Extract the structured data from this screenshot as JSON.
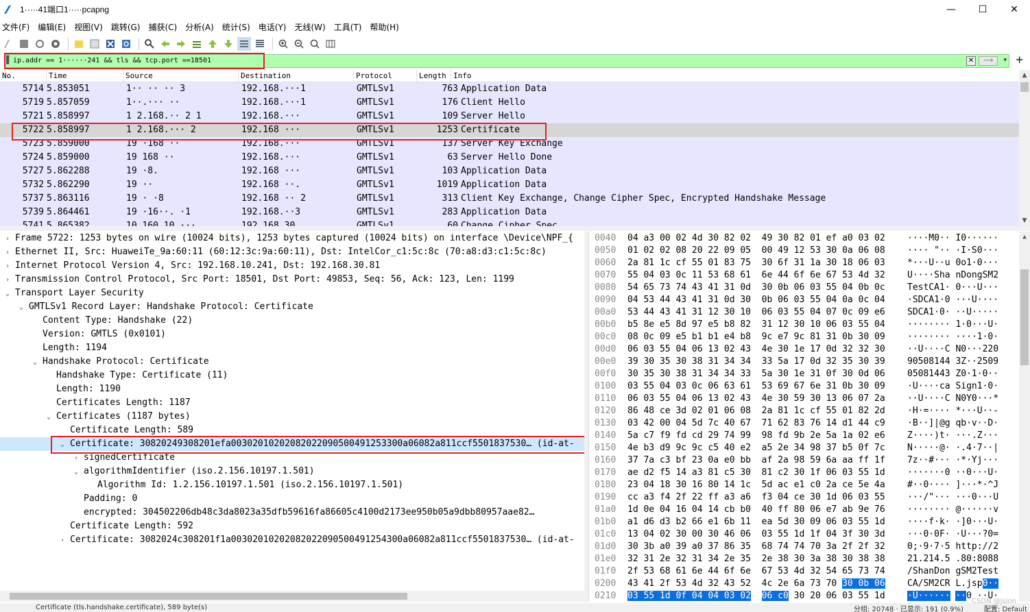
{
  "window": {
    "title": "1·····41端口1·····pcapng",
    "minimize": "—",
    "maximize": "☐",
    "close": "✕"
  },
  "menu": [
    "文件(F)",
    "编辑(E)",
    "视图(V)",
    "跳转(G)",
    "捕获(C)",
    "分析(A)",
    "统计(S)",
    "电话(Y)",
    "无线(W)",
    "工具(T)",
    "帮助(H)"
  ],
  "filter": {
    "value": "ip.addr == 1······241 && tls && tcp.port ==18501",
    "plus": "+"
  },
  "packet_list": {
    "columns": [
      "No.",
      "Time",
      "Source",
      "Destination",
      "Protocol",
      "Length",
      "Info"
    ],
    "rows": [
      {
        "no": "5714",
        "time": "5.853051",
        "src": "1·· ·· ·· 3",
        "dst": "192.168.···1",
        "proto": "GMTLSv1",
        "len": "763",
        "info": "Application Data"
      },
      {
        "no": "5719",
        "time": "5.857059",
        "src": "1··.··· ··",
        "dst": "192.168.···1",
        "proto": "GMTLSv1",
        "len": "176",
        "info": "Client Hello"
      },
      {
        "no": "5721",
        "time": "5.858997",
        "src": "1 2.168.·· 2 1",
        "dst": "192.168.···",
        "proto": "GMTLSv1",
        "len": "109",
        "info": "Server Hello"
      },
      {
        "no": "5722",
        "time": "5.858997",
        "src": "1 2.168.··· 2",
        "dst": "192.168 ···",
        "proto": "GMTLSv1",
        "len": "1253",
        "info": "Certificate"
      },
      {
        "no": "5723",
        "time": "5.859000",
        "src": "19 ·168 ··",
        "dst": "192.168.···",
        "proto": "GMTLSv1",
        "len": "137",
        "info": "Server Key Exchange"
      },
      {
        "no": "5724",
        "time": "5.859000",
        "src": "19 168 ··",
        "dst": "192.168.···",
        "proto": "GMTLSv1",
        "len": "63",
        "info": "Server Hello Done"
      },
      {
        "no": "5727",
        "time": "5.862288",
        "src": "19 ·8.",
        "dst": "192.168 ···",
        "proto": "GMTLSv1",
        "len": "103",
        "info": "Application Data"
      },
      {
        "no": "5732",
        "time": "5.862290",
        "src": "19 ··",
        "dst": "192.168 ··.",
        "proto": "GMTLSv1",
        "len": "1019",
        "info": "Application Data"
      },
      {
        "no": "5737",
        "time": "5.863116",
        "src": "19 · ·8",
        "dst": "192.168 ·· 2",
        "proto": "GMTLSv1",
        "len": "313",
        "info": "Client Key Exchange, Change Cipher Spec, Encrypted Handshake Message"
      },
      {
        "no": "5739",
        "time": "5.864461",
        "src": "19 ·16··. ·1",
        "dst": "192.168.··3",
        "proto": "GMTLSv1",
        "len": "283",
        "info": "Application Data"
      },
      {
        "no": "5741",
        "time": "5.865382",
        "src": "10 160 10 ···",
        "dst": "192.168.30",
        "proto": "GMTLSv1",
        "len": "60",
        "info": "Change Cipher Spec"
      }
    ]
  },
  "details": [
    {
      "indent": 0,
      "arrow": "›",
      "text": "Frame 5722: 1253 bytes on wire (10024 bits), 1253 bytes captured (10024 bits) on interface \\Device\\NPF_{"
    },
    {
      "indent": 0,
      "arrow": "›",
      "text": "Ethernet II, Src: HuaweiTe_9a:60:11 (60:12:3c:9a:60:11), Dst: IntelCor_c1:5c:8c (70:a8:d3:c1:5c:8c)"
    },
    {
      "indent": 0,
      "arrow": "›",
      "text": "Internet Protocol Version 4, Src: 192.168.10.241, Dst: 192.168.30.81"
    },
    {
      "indent": 0,
      "arrow": "›",
      "text": "Transmission Control Protocol, Src Port: 18501, Dst Port: 49853, Seq: 56, Ack: 123, Len: 1199"
    },
    {
      "indent": 0,
      "arrow": "⌄",
      "text": "Transport Layer Security"
    },
    {
      "indent": 1,
      "arrow": "⌄",
      "text": "GMTLSv1 Record Layer: Handshake Protocol: Certificate"
    },
    {
      "indent": 2,
      "arrow": "",
      "text": "Content Type: Handshake (22)"
    },
    {
      "indent": 2,
      "arrow": "",
      "text": "Version: GMTLS (0x0101)"
    },
    {
      "indent": 2,
      "arrow": "",
      "text": "Length: 1194"
    },
    {
      "indent": 2,
      "arrow": "⌄",
      "text": "Handshake Protocol: Certificate"
    },
    {
      "indent": 3,
      "arrow": "",
      "text": "Handshake Type: Certificate (11)"
    },
    {
      "indent": 3,
      "arrow": "",
      "text": "Length: 1190"
    },
    {
      "indent": 3,
      "arrow": "",
      "text": "Certificates Length: 1187"
    },
    {
      "indent": 3,
      "arrow": "⌄",
      "text": "Certificates (1187 bytes)"
    },
    {
      "indent": 4,
      "arrow": "",
      "text": "Certificate Length: 589"
    },
    {
      "indent": 4,
      "arrow": "⌄",
      "text": "Certificate: 30820249308201efa003020102020820220905004912533​00a06082a811ccf5501837530… (id-at-",
      "sel": true
    },
    {
      "indent": 5,
      "arrow": "›",
      "text": "signedCertificate"
    },
    {
      "indent": 5,
      "arrow": "⌄",
      "text": "algorithmIdentifier (iso.2.156.10197.1.501)"
    },
    {
      "indent": 6,
      "arrow": "",
      "text": "Algorithm Id: 1.2.156.10197.1.501 (iso.2.156.10197.1.501)"
    },
    {
      "indent": 5,
      "arrow": "",
      "text": "Padding: 0"
    },
    {
      "indent": 5,
      "arrow": "",
      "text": "encrypted: 304502206db48c3da8023a35dfb59616fa86605c4100d2173ee950b05a9dbb80957aae82…"
    },
    {
      "indent": 4,
      "arrow": "",
      "text": "Certificate Length: 592"
    },
    {
      "indent": 4,
      "arrow": "›",
      "text": "Certificate: 3082024c308201f1a003020102020820220905004912543​00a06082a811ccf5501837530… (id-at-"
    }
  ],
  "hex": [
    {
      "off": "0040",
      "b1": "04 a3 00 02 4d 30 82 02",
      "b2": "49 30 82 01 ef a0 03 02",
      "asc": "····M0·· I0······"
    },
    {
      "off": "0050",
      "b1": "01 02 02 08 20 22 09 05",
      "b2": "00 49 12 53 30 0a 06 08",
      "asc": "···· \"·· ·I·S0···"
    },
    {
      "off": "0060",
      "b1": "2a 81 1c cf 55 01 83 75",
      "b2": "30 6f 31 1a 30 18 06 03",
      "asc": "*···U··u 0o1·0···"
    },
    {
      "off": "0070",
      "b1": "55 04 03 0c 11 53 68 61",
      "b2": "6e 44 6f 6e 67 53 4d 32",
      "asc": "U····Sha nDongSM2"
    },
    {
      "off": "0080",
      "b1": "54 65 73 74 43 41 31 0d",
      "b2": "30 0b 06 03 55 04 0b 0c",
      "asc": "TestCA1· 0···U···"
    },
    {
      "off": "0090",
      "b1": "04 53 44 43 41 31 0d 30",
      "b2": "0b 06 03 55 04 0a 0c 04",
      "asc": "·SDCA1·0 ···U····"
    },
    {
      "off": "00a0",
      "b1": "53 44 43 41 31 12 30 10",
      "b2": "06 03 55 04 07 0c 09 e6",
      "asc": "SDCA1·0· ··U·····"
    },
    {
      "off": "00b0",
      "b1": "b5 8e e5 8d 97 e5 b8 82",
      "b2": "31 12 30 10 06 03 55 04",
      "asc": "········ 1·0···U·"
    },
    {
      "off": "00c0",
      "b1": "08 0c 09 e5 b1 b1 e4 b8",
      "b2": "9c e7 9c 81 31 0b 30 09",
      "asc": "········ ····1·0·"
    },
    {
      "off": "00d0",
      "b1": "06 03 55 04 06 13 02 43",
      "b2": "4e 30 1e 17 0d 32 32 30",
      "asc": "··U····C N0···220"
    },
    {
      "off": "00e0",
      "b1": "39 30 35 30 38 31 34 34",
      "b2": "33 5a 17 0d 32 35 30 39",
      "asc": "90508144 3Z··2509"
    },
    {
      "off": "00f0",
      "b1": "30 35 30 38 31 34 34 33",
      "b2": "5a 30 1e 31 0f 30 0d 06",
      "asc": "05081443 Z0·1·0··"
    },
    {
      "off": "0100",
      "b1": "03 55 04 03 0c 06 63 61",
      "b2": "53 69 67 6e 31 0b 30 09",
      "asc": "·U····ca Sign1·0·"
    },
    {
      "off": "0110",
      "b1": "06 03 55 04 06 13 02 43",
      "b2": "4e 30 59 30 13 06 07 2a",
      "asc": "··U····C N0Y0···*"
    },
    {
      "off": "0120",
      "b1": "86 48 ce 3d 02 01 06 08",
      "b2": "2a 81 1c cf 55 01 82 2d",
      "asc": "·H·=···· *···U··-"
    },
    {
      "off": "0130",
      "b1": "03 42 00 04 5d 7c 40 67",
      "b2": "71 62 83 76 14 d1 44 c9",
      "asc": "·B··]|@g qb·v··D·"
    },
    {
      "off": "0140",
      "b1": "5a c7 f9 fd cd 29 74 99",
      "b2": "98 fd 9b 2e 5a 1a 02 e6",
      "asc": "Z····)t· ···.Z···"
    },
    {
      "off": "0150",
      "b1": "4e b3 d9 9c 9c c5 40 e2",
      "b2": "a5 2e 34 98 37 b5 0f 7c",
      "asc": "N·····@· ·.4·7··|"
    },
    {
      "off": "0160",
      "b1": "37 7a c3 bf 23 0a e0 bb",
      "b2": "af 2a 98 59 6a aa ff 1f",
      "asc": "7z··#··· ·*·Yj···"
    },
    {
      "off": "0170",
      "b1": "ae d2 f5 14 a3 81 c5 30",
      "b2": "81 c2 30 1f 06 03 55 1d",
      "asc": "·······0 ··0···U·"
    },
    {
      "off": "0180",
      "b1": "23 04 18 30 16 80 14 1c",
      "b2": "5d ac e1 c0 2a ce 5e 4a",
      "asc": "#··0···· ]···*·^J"
    },
    {
      "off": "0190",
      "b1": "cc a3 f4 2f 22 ff a3 a6",
      "b2": "f3 04 ce 30 1d 06 03 55",
      "asc": "···/\"··· ···0···U"
    },
    {
      "off": "01a0",
      "b1": "1d 0e 04 16 04 14 cb b0",
      "b2": "40 ff 80 06 e7 ab 9e 76",
      "asc": "········ @······v"
    },
    {
      "off": "01b0",
      "b1": "a1 d6 d3 b2 66 e1 6b 11",
      "b2": "ea 5d 30 09 06 03 55 1d",
      "asc": "····f·k· ·]0···U·"
    },
    {
      "off": "01c0",
      "b1": "13 04 02 30 00 30 46 06",
      "b2": "03 55 1d 1f 04 3f 30 3d",
      "asc": "···0·0F· ·U···?0="
    },
    {
      "off": "01d0",
      "b1": "30 3b a0 39 a0 37 86 35",
      "b2": "68 74 74 70 3a 2f 2f 32",
      "asc": "0;·9·7·5 http://2"
    },
    {
      "off": "01e0",
      "b1": "32 31 2e 32 31 34 2e 35",
      "b2": "2e 38 30 3a 38 30 38 38",
      "asc": "21.214.5 .80:8088"
    },
    {
      "off": "01f0",
      "b1": "2f 53 68 61 6e 44 6f 6e",
      "b2": "67 53 4d 32 54 65 73 74",
      "asc": "/ShanDon gSM2Test"
    },
    {
      "off": "0200",
      "b1": "43 41 2f 53 4d 32 43 52",
      "b2": "4c 2e 6a 73 70",
      "b2hl": "30 0b 06",
      "asc": "CA/SM2CR L.jsp",
      "aschl": "0··"
    },
    {
      "off": "0210",
      "b1hl": "03 55 1d 0f 04 04 03 02",
      "b2hl": "06 c0",
      "b2": "30 20 06 03 55 1d",
      "aschl1": "·U······",
      "aschl2": "··",
      "asc": "0 ··U·"
    }
  ],
  "status": {
    "text": "Certificate (tls.handshake.certificate), 589 byte(s)",
    "right1": "分组: 20748 · 已显示: 191 (0.9%)",
    "right2": "配置: Default"
  },
  "watermark": "CSDN @Jsion"
}
